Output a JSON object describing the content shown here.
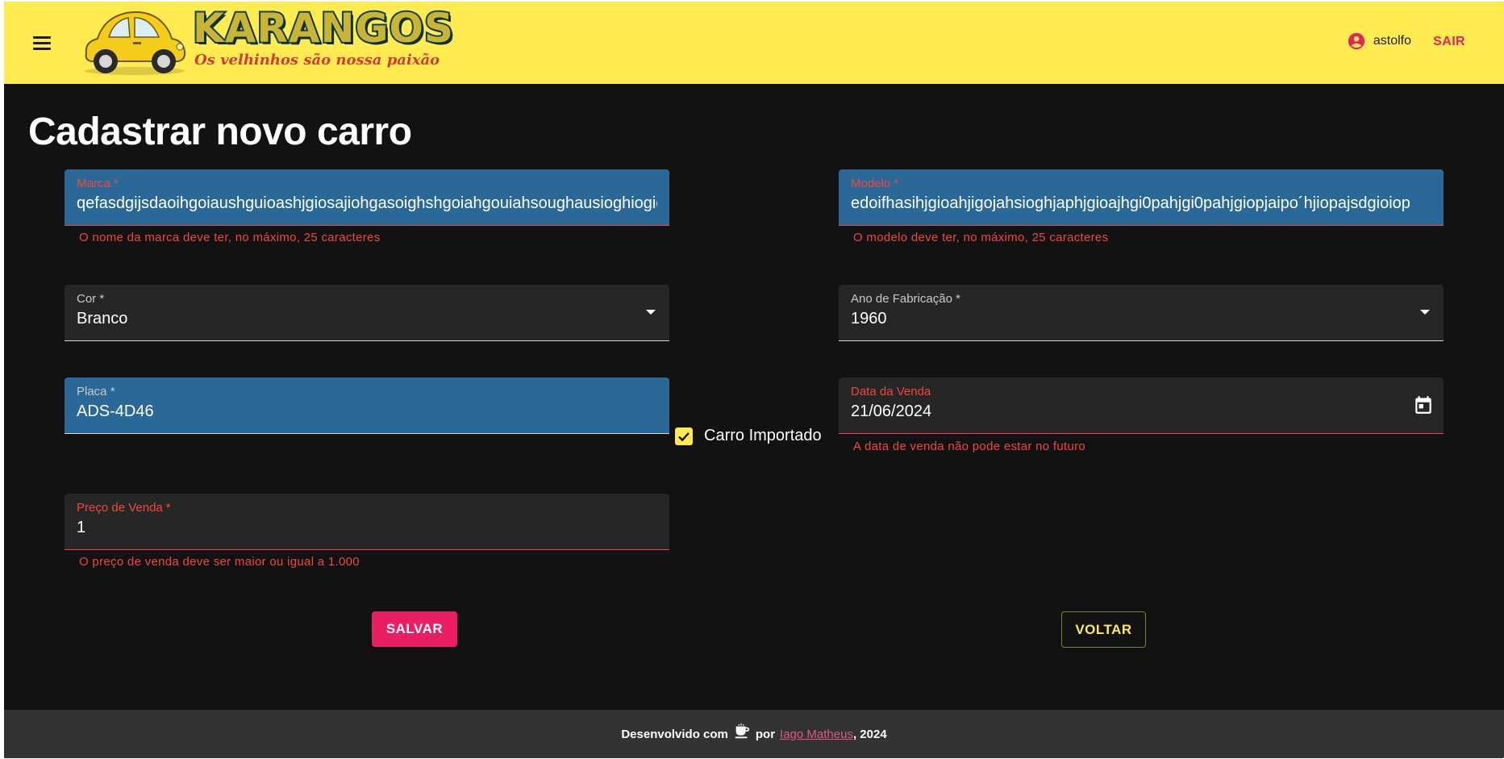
{
  "header": {
    "logo_title": "KARANGOS",
    "logo_subtitle": "Os velhinhos são nossa paixão",
    "username": "astolfo",
    "logout_label": "SAIR",
    "background_color": "#ffeb4f"
  },
  "page": {
    "title": "Cadastrar novo carro"
  },
  "form": {
    "marca": {
      "label": "Marca *",
      "value": "qefasdgijsdaoihgoiaushguioashjgiosajiohgasoighshgoiahgouiahsoughausioghiogiosajiohgasoighs",
      "helper": "O nome da marca deve ter, no máximo, 25 caracteres"
    },
    "modelo": {
      "label": "Modelo *",
      "value": "edoifhasihjgioahjigojahsioghjaphjgioajhgi0pahjgi0pahjgiopjaipo´hjiopajsdgioiop",
      "helper": "O modelo deve ter, no máximo, 25 caracteres"
    },
    "cor": {
      "label": "Cor *",
      "value": "Branco"
    },
    "ano": {
      "label": "Ano de Fabricação *",
      "value": "1960"
    },
    "placa": {
      "label": "Placa *",
      "value": "ADS-4D46"
    },
    "importado": {
      "label": "Carro Importado",
      "checked": true
    },
    "data_venda": {
      "label": "Data da Venda",
      "value": "21/06/2024",
      "helper": "A data de venda não pode estar no futuro"
    },
    "preco": {
      "label": "Preço de Venda *",
      "value": "1",
      "helper": "O preço de venda deve ser maior ou igual a 1.000"
    },
    "save_label": "SALVAR",
    "back_label": "VOLTAR"
  },
  "footer": {
    "prefix": "Desenvolvido com",
    "by": "por",
    "author": "Iago Matheus",
    "year": ", 2024"
  },
  "colors": {
    "primary": "#e91e63",
    "secondary": "#ffeb4f",
    "error": "#f0473c",
    "focused_field": "#2a6897"
  },
  "icons": [
    "menu-icon",
    "car-logo-icon",
    "account-circle-icon",
    "dropdown-arrow-icon",
    "calendar-icon",
    "checkbox-checked-icon",
    "coffee-icon"
  ]
}
